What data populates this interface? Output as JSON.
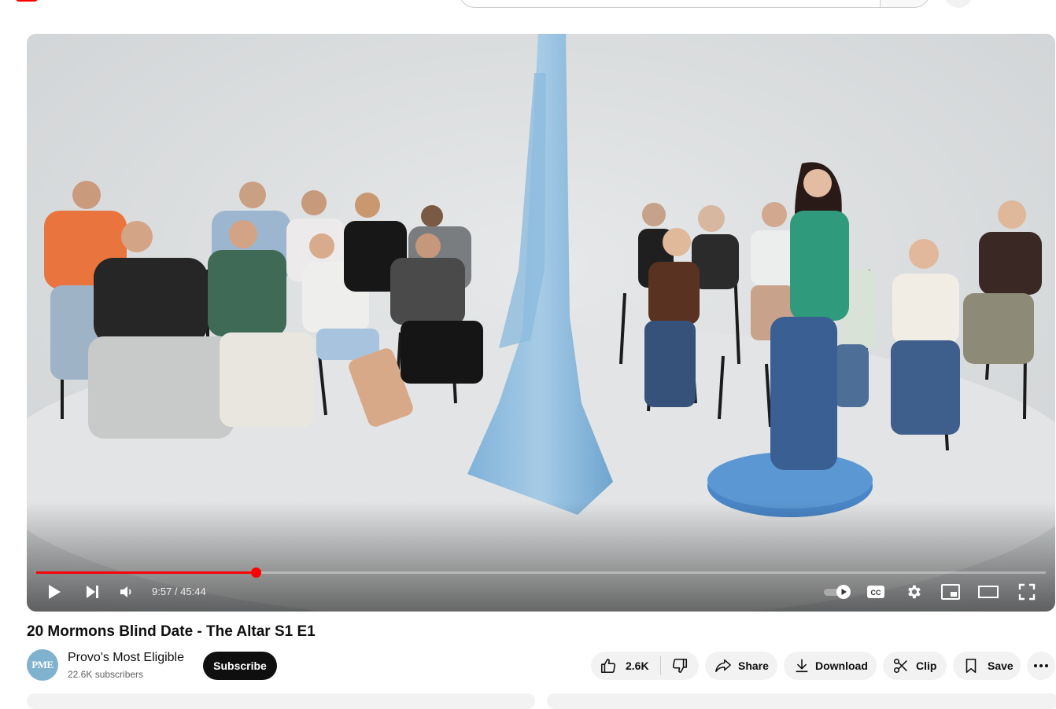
{
  "player": {
    "time_current": "9:57",
    "time_separator": " / ",
    "time_total": "45:44",
    "progress": 0.2178
  },
  "video": {
    "title": "20 Mormons Blind Date - The Altar S1 E1"
  },
  "channel": {
    "name": "Provo's Most Eligible",
    "subscribers": "22.6K subscribers",
    "avatar_text": "PME",
    "subscribe_label": "Subscribe"
  },
  "actions": {
    "like_count": "2.6K",
    "share_label": "Share",
    "download_label": "Download",
    "clip_label": "Clip",
    "save_label": "Save"
  },
  "icons": [
    "play-icon",
    "next-icon",
    "volume-icon",
    "autoplay-toggle-icon",
    "captions-icon",
    "settings-icon",
    "miniplayer-icon",
    "theater-icon",
    "fullscreen-icon",
    "like-icon",
    "dislike-icon",
    "share-icon",
    "download-icon",
    "clip-icon",
    "save-icon",
    "more-icon"
  ],
  "colors": {
    "progress": "#ff0000",
    "subscribe_bg": "#0f0f0f",
    "pill_bg": "#f2f2f2"
  }
}
